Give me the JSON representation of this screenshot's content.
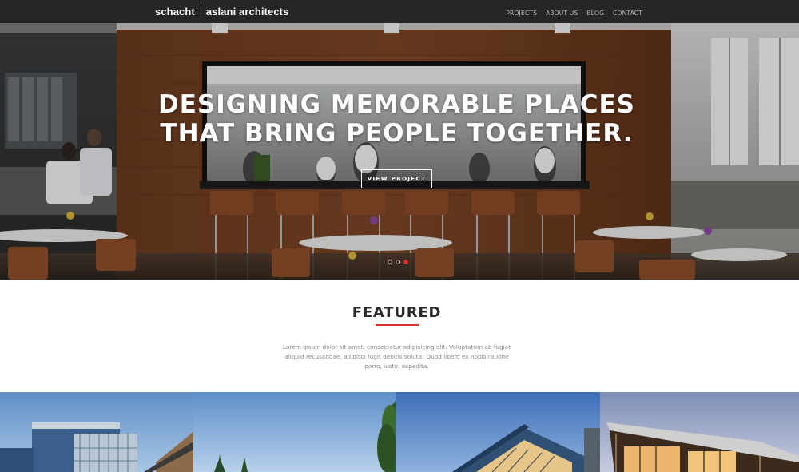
{
  "header": {
    "logo_left": "schacht",
    "logo_right": "aslani architects",
    "nav": [
      "PROJECTS",
      "ABOUT US",
      "BLOG",
      "CONTACT"
    ]
  },
  "hero": {
    "title_line1": "DESIGNING MEMORABLE PLACES",
    "title_line2": "THAT BRING PEOPLE TOGETHER.",
    "button_label": "VIEW PROJECT",
    "slides": 3,
    "active_slide": 3
  },
  "featured": {
    "title": "FEATURED",
    "body": "Lorem ipsum dolor sit amet, consectetur adipisicing elit. Voluptatum ab fugiat aliquid recusandae, adipisci fugit debitis soluta! Quod libero ex nobis ratione porro, iusto, expedita."
  },
  "projects": [
    {
      "image": "glass-office-building-photo"
    },
    {
      "image": "trees-and-sky-photo"
    },
    {
      "image": "modern-facade-photo"
    },
    {
      "image": "pavilion-at-dusk-photo"
    }
  ],
  "colors": {
    "navbar": "#262626",
    "accent": "#d5322c",
    "heading": "#2a2a2a",
    "body_text": "#8a8a8a"
  }
}
